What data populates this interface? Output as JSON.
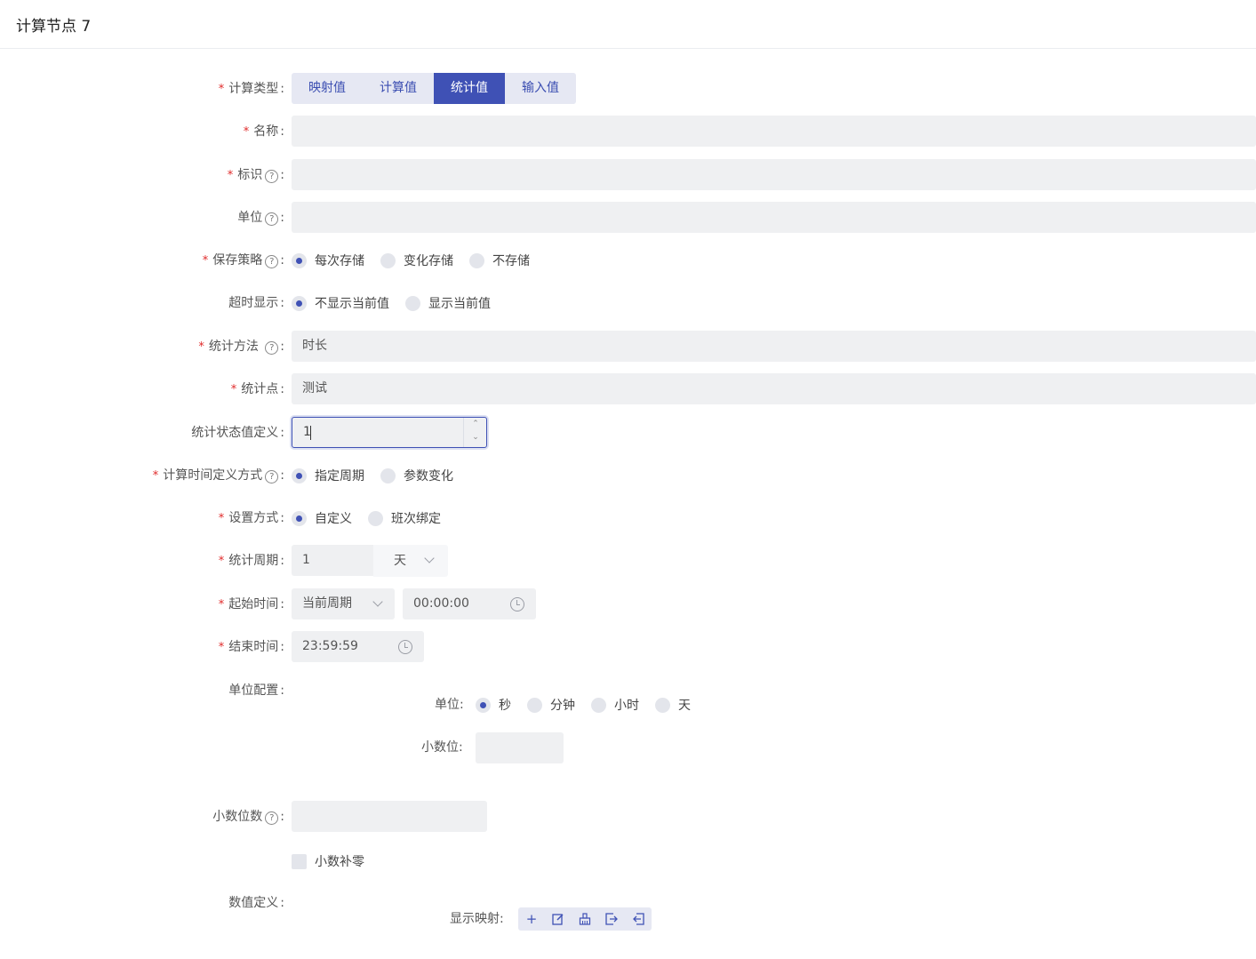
{
  "header": {
    "title": "计算节点 7"
  },
  "form": {
    "calc_type": {
      "label": "计算类型",
      "options": [
        "映射值",
        "计算值",
        "统计值",
        "输入值"
      ],
      "selected": "统计值"
    },
    "name": {
      "label": "名称",
      "value": ""
    },
    "ident": {
      "label": "标识",
      "value": ""
    },
    "unit": {
      "label": "单位",
      "value": ""
    },
    "save_policy": {
      "label": "保存策略",
      "options": [
        "每次存储",
        "变化存储",
        "不存储"
      ],
      "selected": "每次存储"
    },
    "timeout_display": {
      "label": "超时显示",
      "options": [
        "不显示当前值",
        "显示当前值"
      ],
      "selected": "不显示当前值"
    },
    "stat_method": {
      "label": "统计方法",
      "value": "时长"
    },
    "stat_point": {
      "label": "统计点",
      "value": "测试"
    },
    "stat_state_def": {
      "label": "统计状态值定义",
      "value": "1"
    },
    "calc_time_def": {
      "label": "计算时间定义方式",
      "options": [
        "指定周期",
        "参数变化"
      ],
      "selected": "指定周期"
    },
    "setting_mode": {
      "label": "设置方式",
      "options": [
        "自定义",
        "班次绑定"
      ],
      "selected": "自定义"
    },
    "stat_period": {
      "label": "统计周期",
      "value": "1",
      "unit": "天"
    },
    "start_time": {
      "label": "起始时间",
      "period": "当前周期",
      "time": "00:00:00"
    },
    "end_time": {
      "label": "结束时间",
      "time": "23:59:59"
    },
    "unit_config": {
      "label": "单位配置",
      "unit_label": "单位",
      "unit_options": [
        "秒",
        "分钟",
        "小时",
        "天"
      ],
      "unit_selected": "秒",
      "decimals_label": "小数位",
      "decimals_value": ""
    },
    "decimal_places": {
      "label": "小数位数",
      "value": ""
    },
    "pad_zero": {
      "label": "小数补零",
      "checked": false
    },
    "value_def": {
      "label": "数值定义",
      "display_map_label": "显示映射"
    }
  },
  "colors": {
    "primary": "#3f51b5",
    "required": "#e02a2a",
    "field_bg": "#eff0f2"
  }
}
